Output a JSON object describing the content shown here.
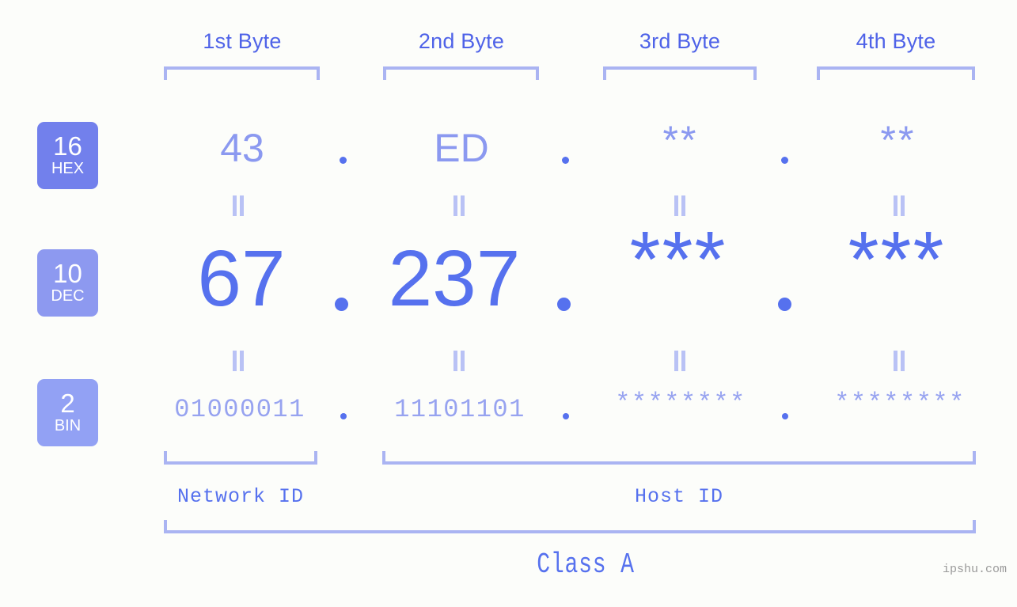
{
  "background_color": "#fcfdfa",
  "accent_color": "#5671ee",
  "accent_light_color": "#8b99f0",
  "bracket_color": "#aab4f2",
  "byte_headers": [
    {
      "label": "1st Byte"
    },
    {
      "label": "2nd Byte"
    },
    {
      "label": "3rd Byte"
    },
    {
      "label": "4th Byte"
    }
  ],
  "bases": [
    {
      "number": "16",
      "name": "HEX",
      "color": "#7280ec"
    },
    {
      "number": "10",
      "name": "DEC",
      "color": "#8d99f0"
    },
    {
      "number": "2",
      "name": "BIN",
      "color": "#92a1f4"
    }
  ],
  "rows": {
    "hex": {
      "base_number": "16",
      "base_name": "HEX",
      "values": [
        "43",
        "ED",
        "**",
        "**"
      ],
      "separator": "."
    },
    "dec": {
      "base_number": "10",
      "base_name": "DEC",
      "values": [
        "67",
        "237",
        "***",
        "***"
      ],
      "separator": "."
    },
    "bin": {
      "base_number": "2",
      "base_name": "BIN",
      "values": [
        "01000011",
        "11101101",
        "********",
        "********"
      ],
      "separator": "."
    }
  },
  "equality_marks": {
    "glyph": "=",
    "hex_to_dec": [
      "=",
      "=",
      "=",
      "="
    ],
    "dec_to_bin": [
      "=",
      "=",
      "=",
      "="
    ]
  },
  "partitions": [
    {
      "label": "Network ID"
    },
    {
      "label": "Host ID"
    }
  ],
  "class": {
    "label": "Class A"
  },
  "watermark": {
    "text": "ipshu.com"
  }
}
